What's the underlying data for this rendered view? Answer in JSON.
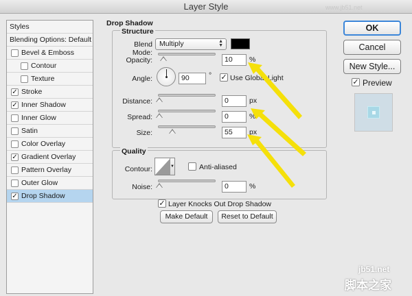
{
  "window": {
    "title": "Layer Style"
  },
  "style_list": {
    "header": "Styles",
    "items": [
      {
        "label": "Blending Options: Default",
        "checkbox": false,
        "checked": false,
        "indent": 0
      },
      {
        "label": "Bevel & Emboss",
        "checkbox": true,
        "checked": false,
        "indent": 0
      },
      {
        "label": "Contour",
        "checkbox": true,
        "checked": false,
        "indent": 1
      },
      {
        "label": "Texture",
        "checkbox": true,
        "checked": false,
        "indent": 1
      },
      {
        "label": "Stroke",
        "checkbox": true,
        "checked": true,
        "indent": 0
      },
      {
        "label": "Inner Shadow",
        "checkbox": true,
        "checked": true,
        "indent": 0
      },
      {
        "label": "Inner Glow",
        "checkbox": true,
        "checked": false,
        "indent": 0
      },
      {
        "label": "Satin",
        "checkbox": true,
        "checked": false,
        "indent": 0
      },
      {
        "label": "Color Overlay",
        "checkbox": true,
        "checked": false,
        "indent": 0
      },
      {
        "label": "Gradient Overlay",
        "checkbox": true,
        "checked": true,
        "indent": 0
      },
      {
        "label": "Pattern Overlay",
        "checkbox": true,
        "checked": false,
        "indent": 0
      },
      {
        "label": "Outer Glow",
        "checkbox": true,
        "checked": false,
        "indent": 0
      },
      {
        "label": "Drop Shadow",
        "checkbox": true,
        "checked": true,
        "indent": 0,
        "selected": true
      }
    ],
    "selected_color": "#b5d5ef"
  },
  "drop_shadow": {
    "section_title": "Drop Shadow",
    "structure": {
      "title": "Structure",
      "blend_mode_label": "Blend Mode:",
      "blend_mode_value": "Multiply",
      "shadow_color": "#000000",
      "opacity_label": "Opacity:",
      "opacity_value": "10",
      "opacity_unit": "%",
      "angle_label": "Angle:",
      "angle_value": "90",
      "angle_unit": "°",
      "use_global_light_label": "Use Global Light",
      "use_global_light_checked": true,
      "distance_label": "Distance:",
      "distance_value": "0",
      "distance_unit": "px",
      "spread_label": "Spread:",
      "spread_value": "0",
      "spread_unit": "%",
      "size_label": "Size:",
      "size_value": "55",
      "size_unit": "px"
    },
    "quality": {
      "title": "Quality",
      "contour_label": "Contour:",
      "anti_aliased_label": "Anti-aliased",
      "anti_aliased_checked": false,
      "noise_label": "Noise:",
      "noise_value": "0",
      "noise_unit": "%"
    },
    "knocks_out_label": "Layer Knocks Out Drop Shadow",
    "knocks_out_checked": true,
    "make_default_label": "Make Default",
    "reset_default_label": "Reset to Default"
  },
  "actions": {
    "ok_label": "OK",
    "cancel_label": "Cancel",
    "new_style_label": "New Style...",
    "preview_label": "Preview",
    "preview_checked": true
  },
  "annotation": {
    "arrow_color": "#f5e00a"
  },
  "watermark": {
    "top_text": "www.jb51.net",
    "site_text": "jb51.net",
    "cn_text": "脚本之家"
  }
}
